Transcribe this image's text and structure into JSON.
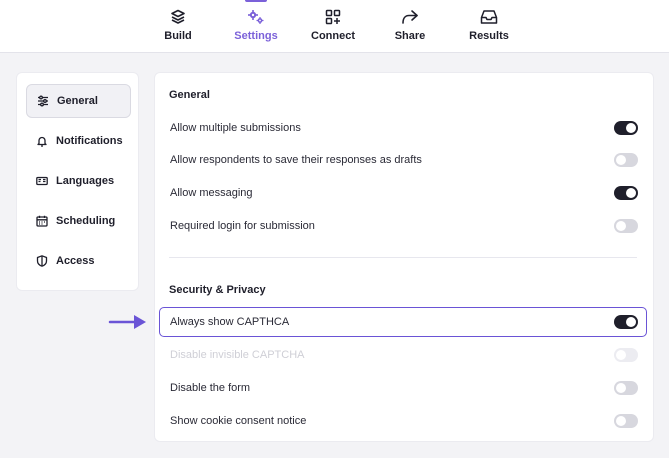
{
  "nav": {
    "tabs": [
      {
        "label": "Build",
        "icon": "layers-icon"
      },
      {
        "label": "Settings",
        "icon": "gears-icon",
        "active": true
      },
      {
        "label": "Connect",
        "icon": "apps-add-icon"
      },
      {
        "label": "Share",
        "icon": "share-arrow-icon"
      },
      {
        "label": "Results",
        "icon": "inbox-icon"
      }
    ]
  },
  "sidebar": {
    "items": [
      {
        "label": "General",
        "icon": "sliders-icon",
        "active": true
      },
      {
        "label": "Notifications",
        "icon": "bell-icon"
      },
      {
        "label": "Languages",
        "icon": "language-card-icon"
      },
      {
        "label": "Scheduling",
        "icon": "calendar-icon"
      },
      {
        "label": "Access",
        "icon": "shield-icon"
      }
    ]
  },
  "general": {
    "title": "General",
    "settings": [
      {
        "label": "Allow multiple submissions",
        "on": true
      },
      {
        "label": "Allow respondents to save their responses as drafts",
        "on": false
      },
      {
        "label": "Allow messaging",
        "on": true
      },
      {
        "label": "Required login for submission",
        "on": false
      }
    ]
  },
  "security": {
    "title": "Security & Privacy",
    "settings": [
      {
        "label": "Always show CAPTHCA",
        "on": true,
        "highlighted": true
      },
      {
        "label": "Disable invisible CAPTCHA",
        "on": false,
        "disabled": true
      },
      {
        "label": "Disable the form",
        "on": false
      },
      {
        "label": "Show cookie consent notice",
        "on": false
      }
    ]
  },
  "colors": {
    "accent": "#7b61d9",
    "highlight_border": "#6a54d6",
    "toggle_on": "#1f1f2b",
    "toggle_off": "#d7d7de"
  }
}
